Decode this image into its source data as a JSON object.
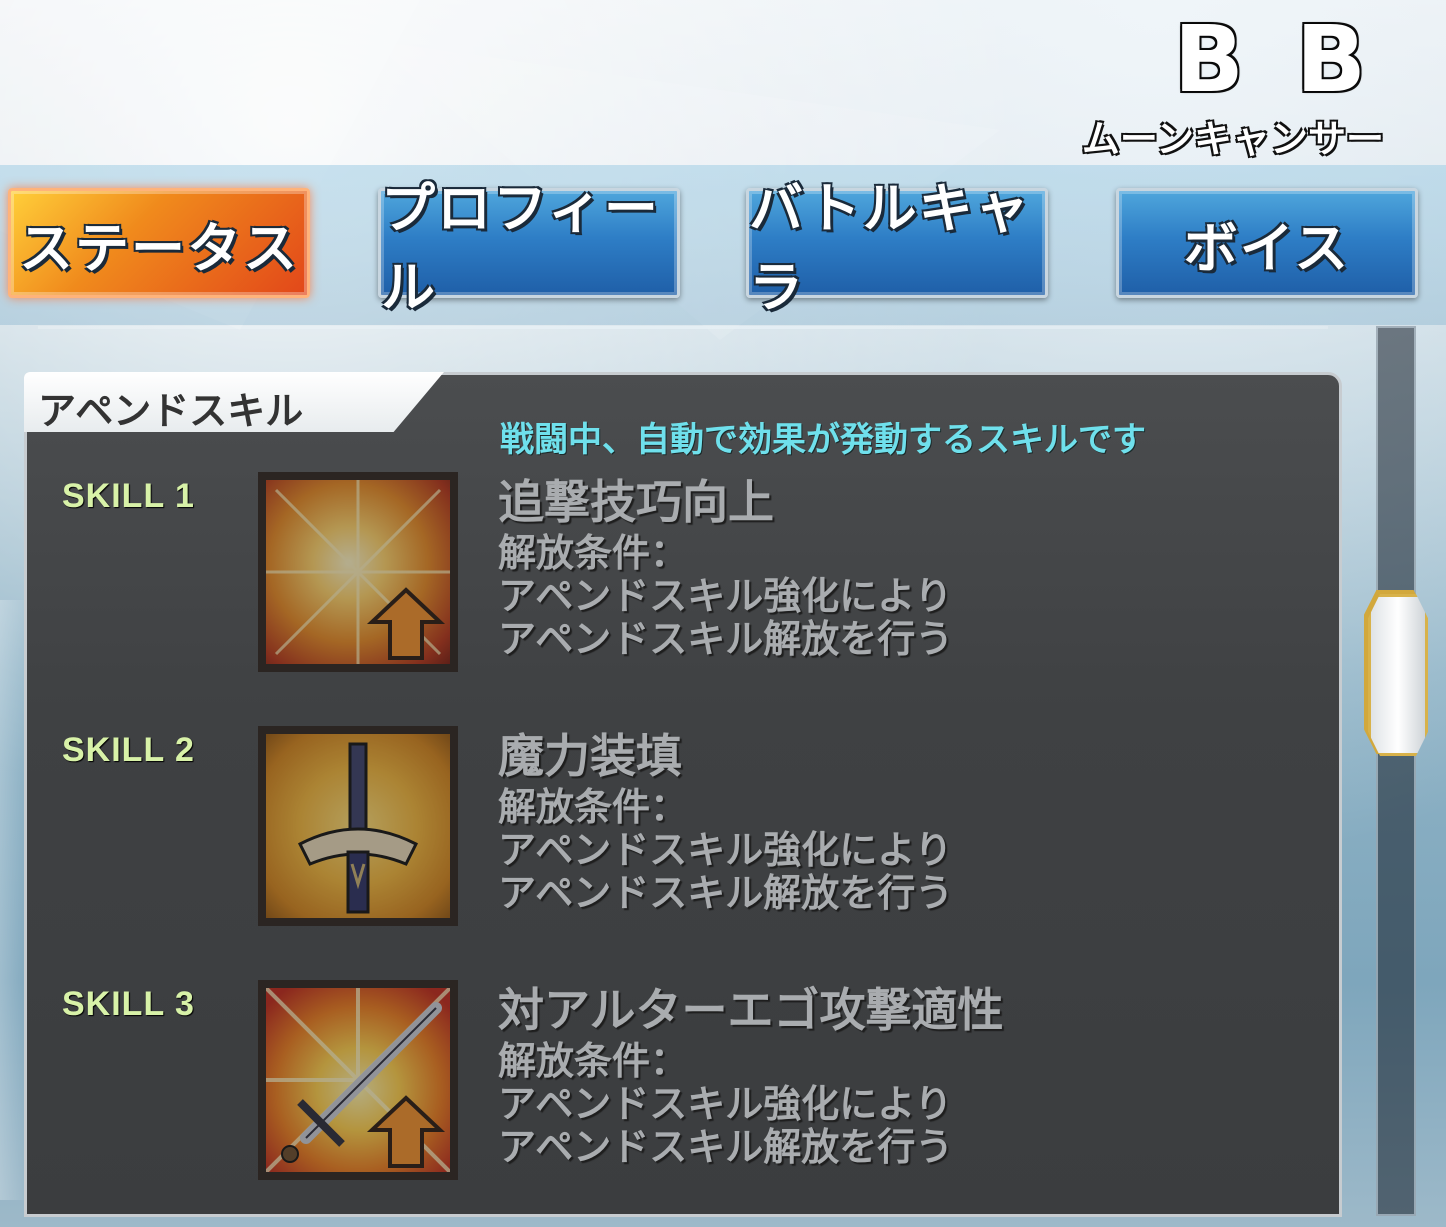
{
  "header": {
    "servant_name": "B B",
    "servant_class": "ムーンキャンサー"
  },
  "tabs": [
    {
      "label": "ステータス",
      "active": true
    },
    {
      "label": "プロフィール",
      "active": false
    },
    {
      "label": "バトルキャラ",
      "active": false
    },
    {
      "label": "ボイス",
      "active": false
    }
  ],
  "panel": {
    "title": "アペンドスキル",
    "description": "戦闘中、自動で効果が発動するスキルです"
  },
  "skills": [
    {
      "label": "SKILL 1",
      "name": "追撃技巧向上",
      "icon": "burst-arrow-up-icon",
      "condition": [
        "解放条件：",
        "アペンドスキル強化により",
        "アペンドスキル解放を行う"
      ]
    },
    {
      "label": "SKILL 2",
      "name": "魔力装填",
      "icon": "sword-hilt-icon",
      "condition": [
        "解放条件：",
        "アペンドスキル強化により",
        "アペンドスキル解放を行う"
      ]
    },
    {
      "label": "SKILL 3",
      "name": "対アルターエゴ攻撃適性",
      "icon": "sword-arrow-up-icon",
      "condition": [
        "解放条件：",
        "アペンドスキル強化により",
        "アペンドスキル解放を行う"
      ]
    }
  ],
  "colors": {
    "active_tab": "#f08a1c",
    "inactive_tab": "#2e7ec6",
    "description": "#6fe0ec",
    "skill_label": "#d8f2a8"
  }
}
